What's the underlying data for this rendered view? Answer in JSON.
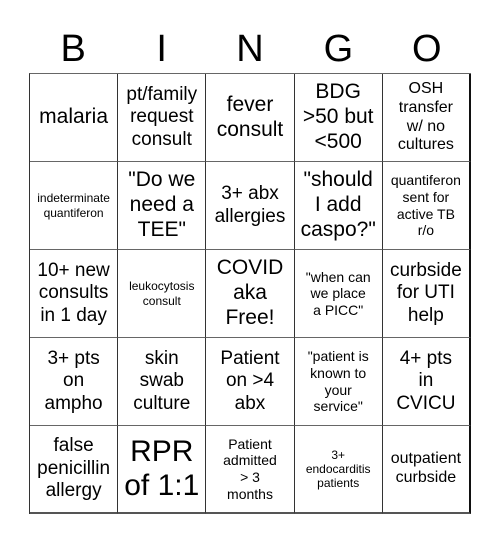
{
  "card": {
    "header": [
      "B",
      "I",
      "N",
      "G",
      "O"
    ],
    "rows": [
      [
        {
          "text": "malaria",
          "size": "l"
        },
        {
          "text": "pt/family\nrequest\nconsult",
          "size": "m"
        },
        {
          "text": "fever\nconsult",
          "size": "l"
        },
        {
          "text": "BDG\n>50 but\n<500",
          "size": "l"
        },
        {
          "text": "OSH\ntransfer\nw/ no\ncultures",
          "size": "s"
        }
      ],
      [
        {
          "text": "indeterminate\nquantiferon",
          "size": "xxs"
        },
        {
          "text": "\"Do we\nneed a\nTEE\"",
          "size": "l"
        },
        {
          "text": "3+ abx\nallergies",
          "size": "m"
        },
        {
          "text": "\"should\nI add\ncaspo?\"",
          "size": "l"
        },
        {
          "text": "quantiferon\nsent for\nactive TB\nr/o",
          "size": "xs"
        }
      ],
      [
        {
          "text": "10+ new\nconsults\nin 1 day",
          "size": "m"
        },
        {
          "text": "leukocytosis\nconsult",
          "size": "xxs"
        },
        {
          "text": "COVID\naka\nFree!",
          "size": "l"
        },
        {
          "text": "\"when can\nwe place\na PICC\"",
          "size": "xs"
        },
        {
          "text": "curbside\nfor UTI\nhelp",
          "size": "m"
        }
      ],
      [
        {
          "text": "3+ pts\non\nampho",
          "size": "m"
        },
        {
          "text": "skin\nswab\nculture",
          "size": "m"
        },
        {
          "text": "Patient\non >4\nabx",
          "size": "m"
        },
        {
          "text": "\"patient is\nknown to\nyour\nservice\"",
          "size": "xs"
        },
        {
          "text": "4+ pts\nin\nCVICU",
          "size": "m"
        }
      ],
      [
        {
          "text": "false\npenicillin\nallergy",
          "size": "m"
        },
        {
          "text": "RPR\nof 1:1",
          "size": "xl"
        },
        {
          "text": "Patient\nadmitted\n> 3\nmonths",
          "size": "xs"
        },
        {
          "text": "3+\nendocarditis\npatients",
          "size": "xxs"
        },
        {
          "text": "outpatient\ncurbside",
          "size": "s"
        }
      ]
    ]
  }
}
